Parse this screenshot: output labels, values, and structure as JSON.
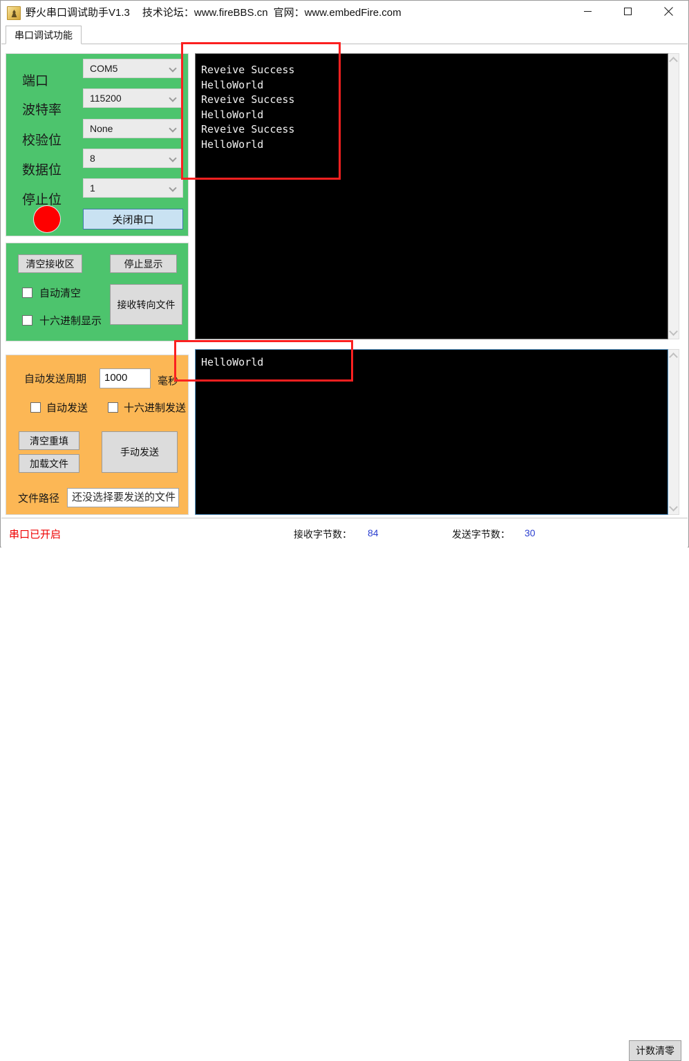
{
  "window": {
    "app_icon": "firefly-logo-icon",
    "title": "野火串口调试助手V1.3",
    "subtitle_forum": "技术论坛：www.fireBBS.cn",
    "subtitle_site": "官网：www.embedFire.com",
    "minimize_icon": "minimize-icon",
    "maximize_icon": "maximize-icon",
    "close_icon": "close-icon"
  },
  "tabs": [
    {
      "label": "串口调试功能",
      "active": true
    }
  ],
  "port_panel": {
    "accent_color": "#4dc46d",
    "rows": [
      {
        "label": "端口",
        "value": "COM5"
      },
      {
        "label": "波特率",
        "value": "115200"
      },
      {
        "label": "校验位",
        "value": "None"
      },
      {
        "label": "数据位",
        "value": "8"
      },
      {
        "label": "停止位",
        "value": "1"
      }
    ],
    "status_led_color": "#fe0000",
    "toggle_button": "关闭串口"
  },
  "receive_panel": {
    "accent_color": "#4dc46d",
    "clear_button": "清空接收区",
    "stop_button": "停止显示",
    "auto_clear_checkbox": {
      "label": "自动清空",
      "checked": false
    },
    "hex_display_checkbox": {
      "label": "十六进制显示",
      "checked": false
    },
    "save_to_file_button": "接收转向文件"
  },
  "send_panel": {
    "accent_color": "#fcb755",
    "period_label": "自动发送周期",
    "period_value": "1000",
    "period_unit": "毫秒",
    "auto_send_checkbox": {
      "label": "自动发送",
      "checked": false
    },
    "hex_send_checkbox": {
      "label": "十六进制发送",
      "checked": false
    },
    "clear_refill_button": "清空重填",
    "load_file_button": "加载文件",
    "manual_send_button": "手动发送",
    "file_path_label": "文件路径",
    "file_path_value": "还没选择要发送的文件"
  },
  "receive_area": {
    "text": "Reveive Success\nHelloWorld\nReveive Success\nHelloWorld\nReveive Success\nHelloWorld",
    "background": "#000000",
    "foreground": "#f2f2f2"
  },
  "send_area": {
    "text": "HelloWorld",
    "background": "#000000",
    "foreground": "#f2f2f2",
    "focused": true
  },
  "status_bar": {
    "port_state": "串口已开启",
    "port_state_color": "#ee0000",
    "received_label": "接收字节数：",
    "received_value": "84",
    "sent_label": "发送字节数：",
    "sent_value": "30",
    "counter_value_color": "#2b3fd0",
    "clear_counter_button": "计数清零"
  },
  "annotations": {
    "color": "#fb2020",
    "boxes": [
      {
        "name": "receive-text-highlight"
      },
      {
        "name": "send-text-highlight"
      }
    ]
  }
}
